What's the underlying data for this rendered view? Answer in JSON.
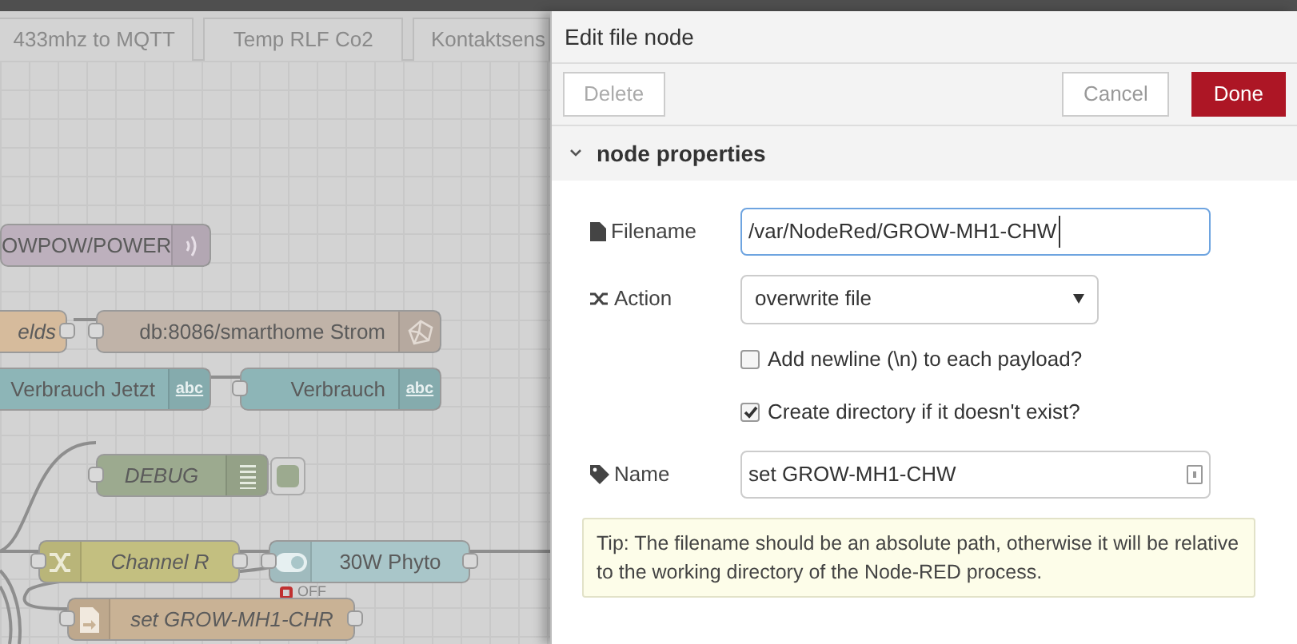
{
  "canvas": {
    "tabs": [
      {
        "label": "433mhz to MQTT",
        "selected": false
      },
      {
        "label": "Temp RLF Co2",
        "selected": false
      },
      {
        "label": "Kontaktsens",
        "selected": false
      }
    ],
    "nodes": [
      {
        "kind": "mqtt",
        "label": "OWPOW/POWER"
      },
      {
        "kind": "function",
        "label": "elds"
      },
      {
        "kind": "influx",
        "label": "db:8086/smarthome Strom"
      },
      {
        "kind": "text",
        "label": "Verbrauch Jetzt",
        "badge": "abc"
      },
      {
        "kind": "text",
        "label": "Verbrauch",
        "badge": "abc"
      },
      {
        "kind": "debug",
        "label": "DEBUG"
      },
      {
        "kind": "change",
        "label": "Channel R"
      },
      {
        "kind": "toggle",
        "label": "30W Phyto",
        "status": "OFF"
      },
      {
        "kind": "file",
        "label": "set GROW-MH1-CHR"
      }
    ]
  },
  "panel": {
    "title": "Edit file node",
    "buttons": [
      {
        "kind": "delete",
        "label": "Delete",
        "disabled": true
      },
      {
        "kind": "cancel",
        "label": "Cancel",
        "disabled": false
      },
      {
        "kind": "done",
        "label": "Done",
        "disabled": false
      }
    ],
    "section": {
      "label": "node properties",
      "expanded": true
    },
    "fields": [
      {
        "kind": "input",
        "label": "Filename",
        "value": "/var/NodeRed/GROW-MH1-CHW",
        "focused": true
      },
      {
        "kind": "select",
        "label": "Action",
        "value": "overwrite file"
      },
      {
        "kind": "checkbox",
        "label": "Add newline (\\n) to each payload?",
        "checked": false
      },
      {
        "kind": "checkbox",
        "label": "Create directory if it doesn't exist?",
        "checked": true
      },
      {
        "kind": "input",
        "label": "Name",
        "value": "set GROW-MH1-CHW",
        "focused": false
      }
    ],
    "tip": "Tip: The filename should be an absolute path, otherwise it will be relative to the working directory of the Node-RED process."
  }
}
